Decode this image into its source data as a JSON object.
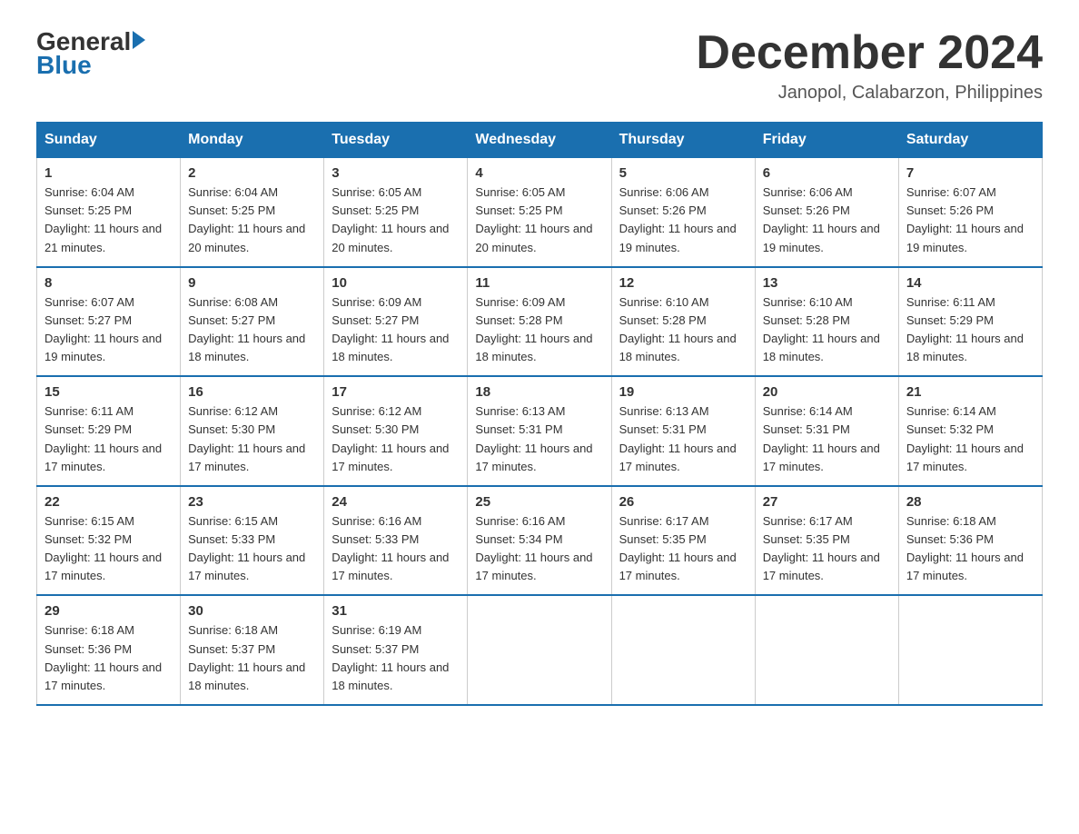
{
  "header": {
    "logo_general": "General",
    "logo_blue": "Blue",
    "month_title": "December 2024",
    "location": "Janopol, Calabarzon, Philippines"
  },
  "weekdays": [
    "Sunday",
    "Monday",
    "Tuesday",
    "Wednesday",
    "Thursday",
    "Friday",
    "Saturday"
  ],
  "weeks": [
    [
      {
        "day": "1",
        "sunrise": "6:04 AM",
        "sunset": "5:25 PM",
        "daylight": "11 hours and 21 minutes."
      },
      {
        "day": "2",
        "sunrise": "6:04 AM",
        "sunset": "5:25 PM",
        "daylight": "11 hours and 20 minutes."
      },
      {
        "day": "3",
        "sunrise": "6:05 AM",
        "sunset": "5:25 PM",
        "daylight": "11 hours and 20 minutes."
      },
      {
        "day": "4",
        "sunrise": "6:05 AM",
        "sunset": "5:25 PM",
        "daylight": "11 hours and 20 minutes."
      },
      {
        "day": "5",
        "sunrise": "6:06 AM",
        "sunset": "5:26 PM",
        "daylight": "11 hours and 19 minutes."
      },
      {
        "day": "6",
        "sunrise": "6:06 AM",
        "sunset": "5:26 PM",
        "daylight": "11 hours and 19 minutes."
      },
      {
        "day": "7",
        "sunrise": "6:07 AM",
        "sunset": "5:26 PM",
        "daylight": "11 hours and 19 minutes."
      }
    ],
    [
      {
        "day": "8",
        "sunrise": "6:07 AM",
        "sunset": "5:27 PM",
        "daylight": "11 hours and 19 minutes."
      },
      {
        "day": "9",
        "sunrise": "6:08 AM",
        "sunset": "5:27 PM",
        "daylight": "11 hours and 18 minutes."
      },
      {
        "day": "10",
        "sunrise": "6:09 AM",
        "sunset": "5:27 PM",
        "daylight": "11 hours and 18 minutes."
      },
      {
        "day": "11",
        "sunrise": "6:09 AM",
        "sunset": "5:28 PM",
        "daylight": "11 hours and 18 minutes."
      },
      {
        "day": "12",
        "sunrise": "6:10 AM",
        "sunset": "5:28 PM",
        "daylight": "11 hours and 18 minutes."
      },
      {
        "day": "13",
        "sunrise": "6:10 AM",
        "sunset": "5:28 PM",
        "daylight": "11 hours and 18 minutes."
      },
      {
        "day": "14",
        "sunrise": "6:11 AM",
        "sunset": "5:29 PM",
        "daylight": "11 hours and 18 minutes."
      }
    ],
    [
      {
        "day": "15",
        "sunrise": "6:11 AM",
        "sunset": "5:29 PM",
        "daylight": "11 hours and 17 minutes."
      },
      {
        "day": "16",
        "sunrise": "6:12 AM",
        "sunset": "5:30 PM",
        "daylight": "11 hours and 17 minutes."
      },
      {
        "day": "17",
        "sunrise": "6:12 AM",
        "sunset": "5:30 PM",
        "daylight": "11 hours and 17 minutes."
      },
      {
        "day": "18",
        "sunrise": "6:13 AM",
        "sunset": "5:31 PM",
        "daylight": "11 hours and 17 minutes."
      },
      {
        "day": "19",
        "sunrise": "6:13 AM",
        "sunset": "5:31 PM",
        "daylight": "11 hours and 17 minutes."
      },
      {
        "day": "20",
        "sunrise": "6:14 AM",
        "sunset": "5:31 PM",
        "daylight": "11 hours and 17 minutes."
      },
      {
        "day": "21",
        "sunrise": "6:14 AM",
        "sunset": "5:32 PM",
        "daylight": "11 hours and 17 minutes."
      }
    ],
    [
      {
        "day": "22",
        "sunrise": "6:15 AM",
        "sunset": "5:32 PM",
        "daylight": "11 hours and 17 minutes."
      },
      {
        "day": "23",
        "sunrise": "6:15 AM",
        "sunset": "5:33 PM",
        "daylight": "11 hours and 17 minutes."
      },
      {
        "day": "24",
        "sunrise": "6:16 AM",
        "sunset": "5:33 PM",
        "daylight": "11 hours and 17 minutes."
      },
      {
        "day": "25",
        "sunrise": "6:16 AM",
        "sunset": "5:34 PM",
        "daylight": "11 hours and 17 minutes."
      },
      {
        "day": "26",
        "sunrise": "6:17 AM",
        "sunset": "5:35 PM",
        "daylight": "11 hours and 17 minutes."
      },
      {
        "day": "27",
        "sunrise": "6:17 AM",
        "sunset": "5:35 PM",
        "daylight": "11 hours and 17 minutes."
      },
      {
        "day": "28",
        "sunrise": "6:18 AM",
        "sunset": "5:36 PM",
        "daylight": "11 hours and 17 minutes."
      }
    ],
    [
      {
        "day": "29",
        "sunrise": "6:18 AM",
        "sunset": "5:36 PM",
        "daylight": "11 hours and 17 minutes."
      },
      {
        "day": "30",
        "sunrise": "6:18 AM",
        "sunset": "5:37 PM",
        "daylight": "11 hours and 18 minutes."
      },
      {
        "day": "31",
        "sunrise": "6:19 AM",
        "sunset": "5:37 PM",
        "daylight": "11 hours and 18 minutes."
      },
      null,
      null,
      null,
      null
    ]
  ],
  "colors": {
    "header_bg": "#1a6faf",
    "header_text": "#ffffff",
    "border": "#1a6faf"
  }
}
